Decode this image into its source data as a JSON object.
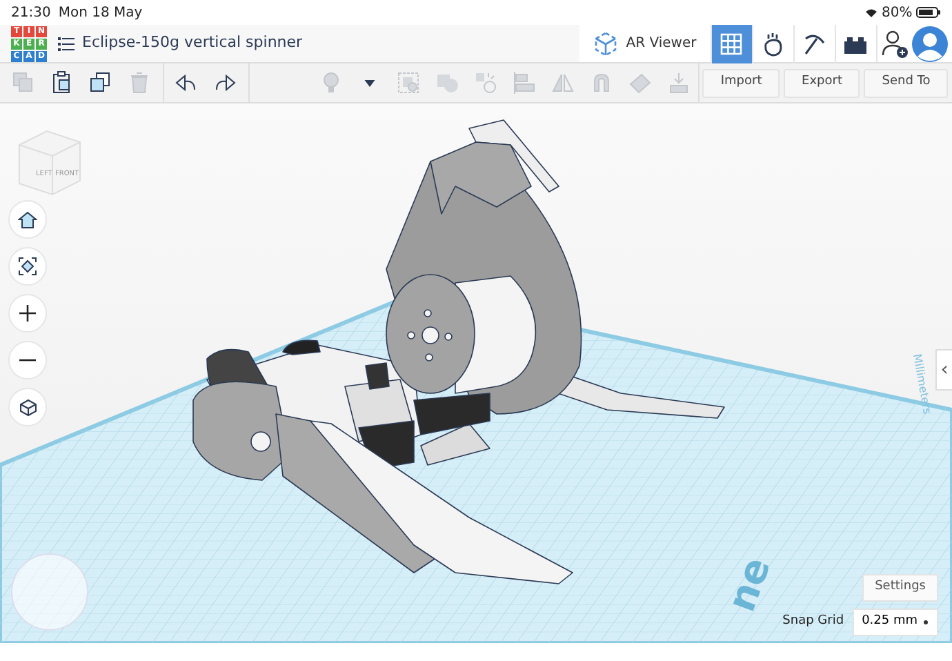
{
  "status_bar": {
    "time": "21:30",
    "date": "Mon 18 May",
    "battery": "80%"
  },
  "header": {
    "logo_letters": [
      "T",
      "I",
      "N",
      "K",
      "E",
      "R",
      "C",
      "A",
      "D"
    ],
    "title": "Eclipse-150g vertical spinner",
    "ar_viewer": "AR Viewer",
    "views": [
      {
        "selected": true
      },
      {
        "selected": false
      },
      {
        "selected": false
      },
      {
        "selected": false
      }
    ]
  },
  "toolbar": {
    "tools": [
      {
        "disabled": true
      },
      {
        "disabled": false
      },
      {
        "disabled": false
      },
      {
        "disabled": true
      },
      {
        "disabled": false
      },
      {
        "disabled": false
      }
    ],
    "shape_tools": [
      {
        "disabled": true
      },
      {
        "disabled": false
      },
      {
        "disabled": true
      },
      {
        "disabled": true
      },
      {
        "disabled": true
      },
      {
        "disabled": true
      },
      {
        "disabled": true
      },
      {
        "disabled": true
      },
      {
        "disabled": true
      },
      {
        "disabled": true
      }
    ],
    "buttons": [
      "Import",
      "Export",
      "Send To"
    ]
  },
  "view_cube": {
    "faces": [
      "LEFT",
      "FRONT"
    ]
  },
  "workplane": {
    "labels": [
      "Millimeters",
      "ne"
    ]
  },
  "panel_handle": "‹",
  "settings": "Settings",
  "snap_grid": {
    "label": "Snap Grid",
    "value": "0.25 mm"
  }
}
